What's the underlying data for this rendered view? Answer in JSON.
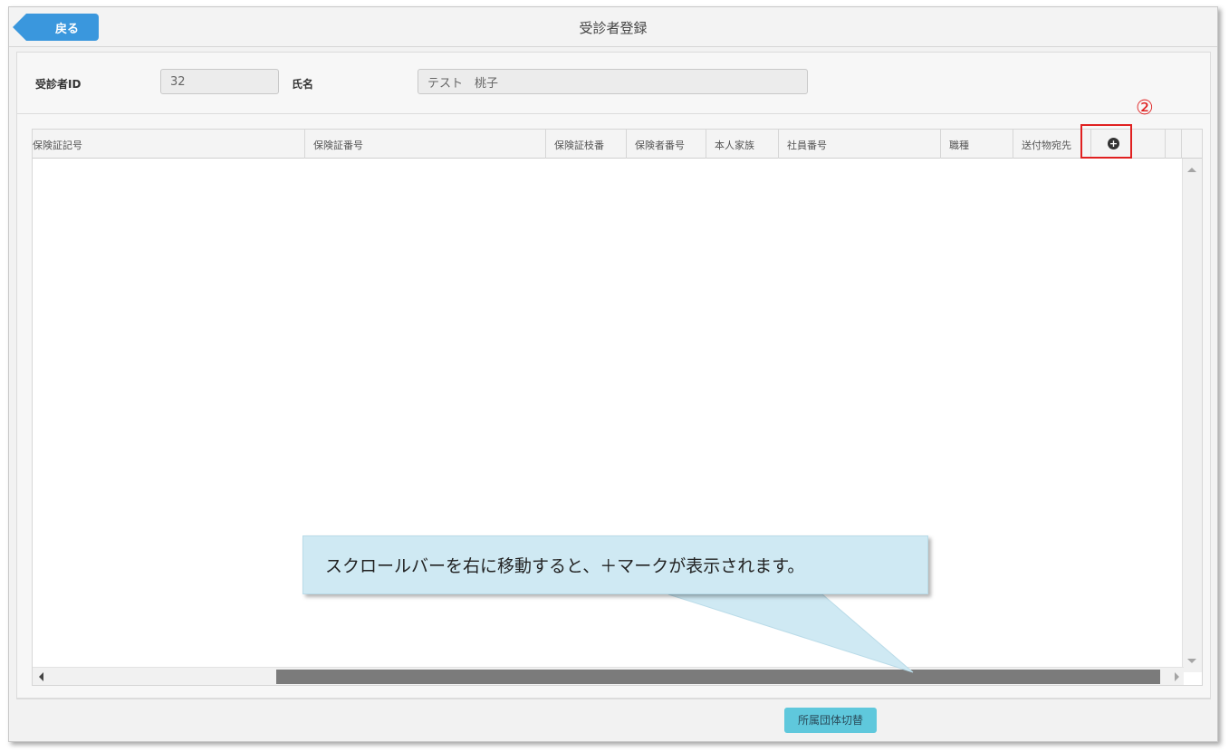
{
  "header": {
    "back_label": "戻る",
    "title": "受診者登録"
  },
  "form": {
    "id_label": "受診者ID",
    "id_value": "32",
    "name_label": "氏名",
    "name_value": "テスト　桃子"
  },
  "grid": {
    "columns": [
      "保険証記号",
      "保険証番号",
      "保険証枝番",
      "保険者番号",
      "本人家族",
      "社員番号",
      "職種",
      "送付物宛先"
    ],
    "rows": []
  },
  "annotation": {
    "marker": "②",
    "callout_text": "スクロールバーを右に移動すると、＋マークが表示されます。",
    "highlight_color": "#e02020"
  },
  "footer": {
    "switch_button_label": "所属団体切替"
  },
  "colors": {
    "accent": "#3a97dd",
    "footer_button": "#5fc8dc",
    "callout_bg": "#cfe9f3"
  },
  "icons": {
    "add": "plus-circle-icon"
  }
}
